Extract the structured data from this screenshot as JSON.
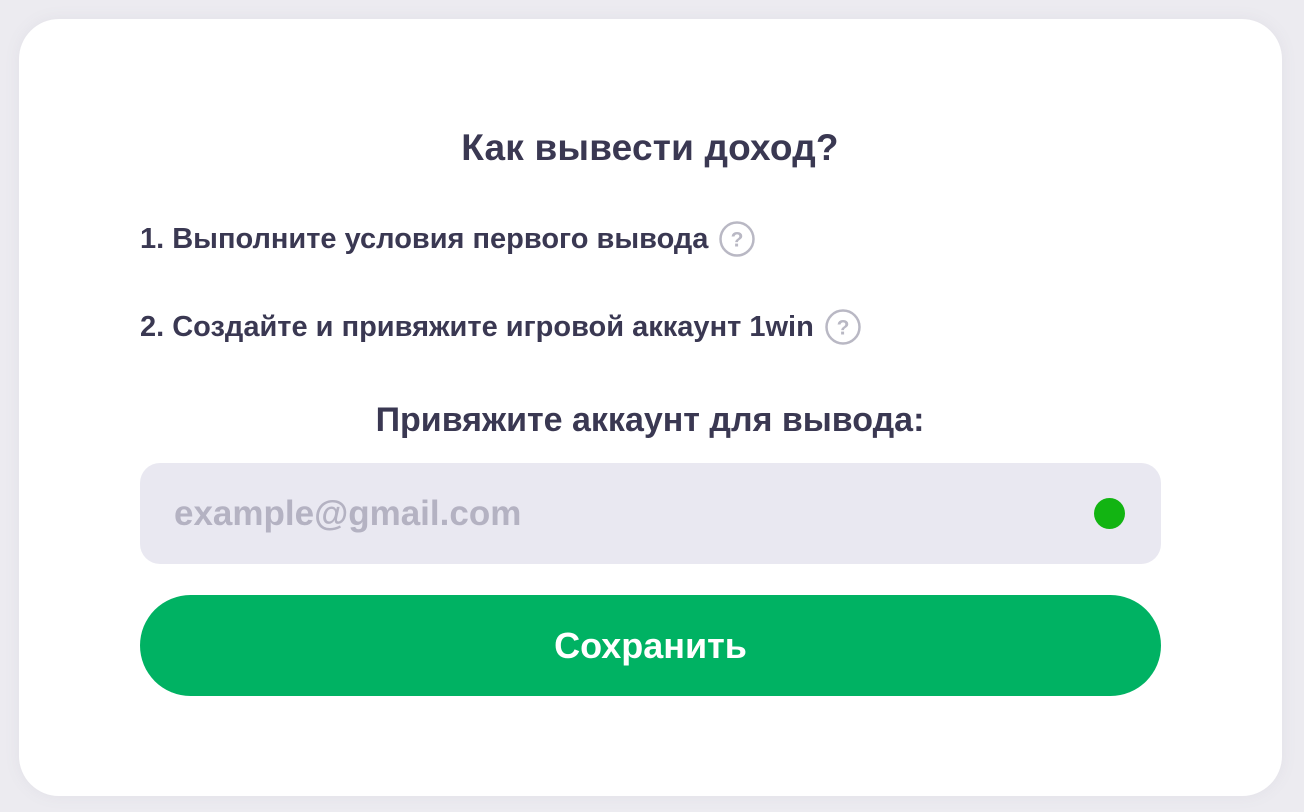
{
  "dialog": {
    "title": "Как вывести доход?",
    "steps": [
      {
        "text": "1. Выполните условия первого вывода",
        "help_icon": "question-circle-icon"
      },
      {
        "text": "2. Создайте и привяжите игровой аккаунт 1win",
        "help_icon": "question-circle-icon"
      }
    ],
    "subtitle": "Привяжите аккаунт для вывода:",
    "email": {
      "value": "",
      "placeholder": "example@gmail.com",
      "status_color": "#12B412"
    },
    "save_label": "Сохранить"
  },
  "colors": {
    "background": "#ECEBF0",
    "card": "#FFFFFF",
    "text": "#3A3852",
    "field_bg": "#E9E8F1",
    "placeholder": "#B4B2C2",
    "primary_button": "#00B263",
    "icon_outline": "#B9B8C4"
  }
}
